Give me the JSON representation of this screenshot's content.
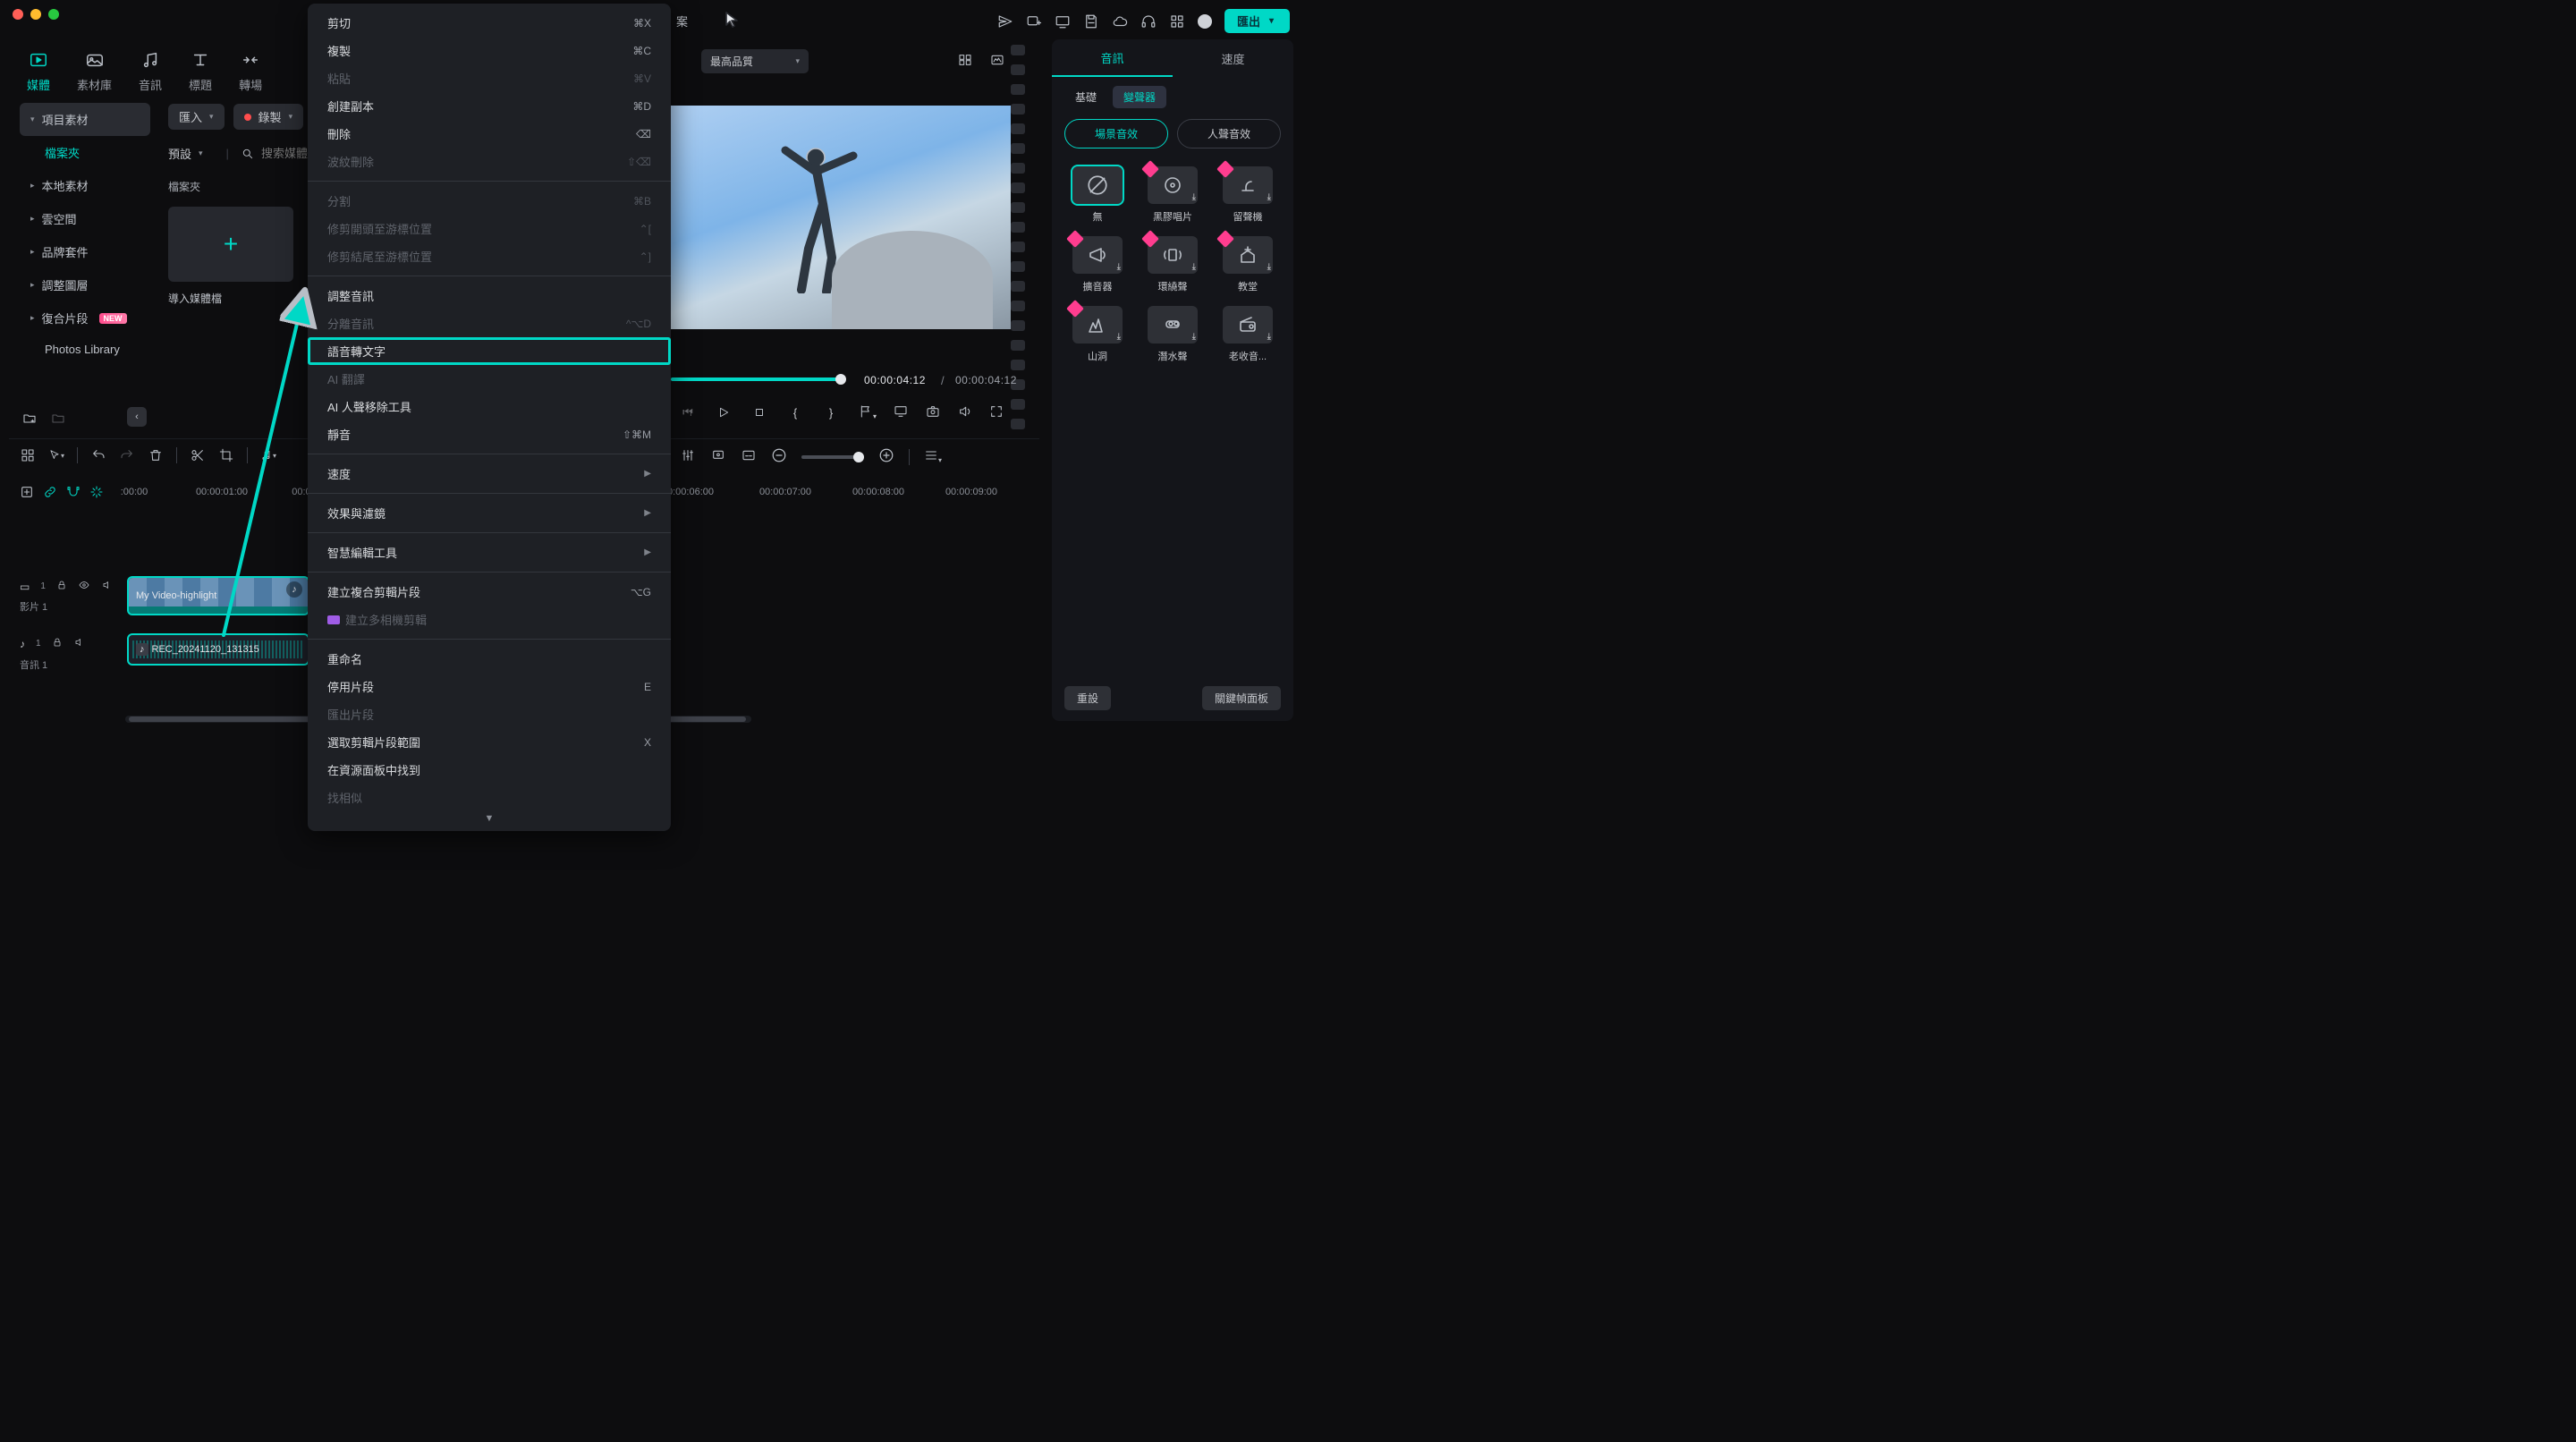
{
  "top": {
    "project_suffix": "案",
    "export": "匯出"
  },
  "main_tabs": {
    "media": "媒體",
    "stock": "素材庫",
    "audio": "音訊",
    "title": "標題",
    "transition": "轉場"
  },
  "sidebar": {
    "project_assets": "項目素材",
    "folder": "檔案夾",
    "local": "本地素材",
    "cloud": "雲空間",
    "brand": "品牌套件",
    "adjust_layer": "調整圖層",
    "compound": "復合片段",
    "new_badge": "NEW",
    "photos": "Photos Library"
  },
  "media_panel": {
    "import": "匯入",
    "record": "錄製",
    "preset": "預設",
    "search_placeholder": "搜索媒體",
    "folder_label": "檔案夾",
    "import_caption": "導入媒體檔"
  },
  "quality": {
    "label": "最高品質"
  },
  "preview": {
    "time_current": "00:00:04:12",
    "time_duration": "00:00:04:12"
  },
  "ruler": {
    "t0": ":00:00",
    "t1": "00:00:01:00",
    "t2": "00:00",
    "t6": "0:00:06:00",
    "t7": "00:00:07:00",
    "t8": "00:00:08:00",
    "t9": "00:00:09:00"
  },
  "tracks": {
    "video_label": "影片 1",
    "audio_label": "音訊 1",
    "video_clip_name": "My Video-highlight",
    "audio_clip_name": "REC_20241120_131315",
    "count1": "1"
  },
  "ctx": {
    "cut": "剪切",
    "cut_sc": "⌘X",
    "copy": "複製",
    "copy_sc": "⌘C",
    "paste": "粘貼",
    "paste_sc": "⌘V",
    "duplicate": "創建副本",
    "duplicate_sc": "⌘D",
    "delete": "刪除",
    "delete_sc": "⌫",
    "ripple_delete": "波紋刪除",
    "ripple_delete_sc": "⇧⌫",
    "split": "分割",
    "split_sc": "⌘B",
    "trim_start": "修剪開頭至游標位置",
    "trim_start_sc": "⌃[",
    "trim_end": "修剪結尾至游標位置",
    "trim_end_sc": "⌃]",
    "adjust_audio": "調整音訊",
    "detach_audio": "分離音訊",
    "detach_sc": "^⌥D",
    "stt": "語音轉文字",
    "ai_translate": "AI 翻譯",
    "ai_vocal_remove": "AI 人聲移除工具",
    "mute": "靜音",
    "mute_sc": "⇧⌘M",
    "speed": "速度",
    "fx": "效果與濾鏡",
    "smart": "智慧編輯工具",
    "compound": "建立複合剪輯片段",
    "compound_sc": "⌥G",
    "multicam": "建立多相機剪輯",
    "rename": "重命名",
    "disable": "停用片段",
    "disable_sc": "E",
    "export_clip": "匯出片段",
    "select_range": "選取剪輯片段範圍",
    "select_range_sc": "X",
    "reveal": "在資源面板中找到",
    "find_similar": "找相似"
  },
  "rpanel": {
    "tab_audio": "音訊",
    "tab_speed": "速度",
    "sub_basic": "基礎",
    "sub_voice": "變聲器",
    "mode_scene": "場景音效",
    "mode_vocal": "人聲音效",
    "fx": {
      "none": "無",
      "vinyl": "黑膠唱片",
      "gramophone": "留聲機",
      "amp": "擴音器",
      "surround": "環繞聲",
      "church": "教堂",
      "cave": "山洞",
      "dive": "潛水聲",
      "radio": "老收音..."
    },
    "reset": "重設",
    "keyframe_panel": "關鍵幀面板"
  }
}
